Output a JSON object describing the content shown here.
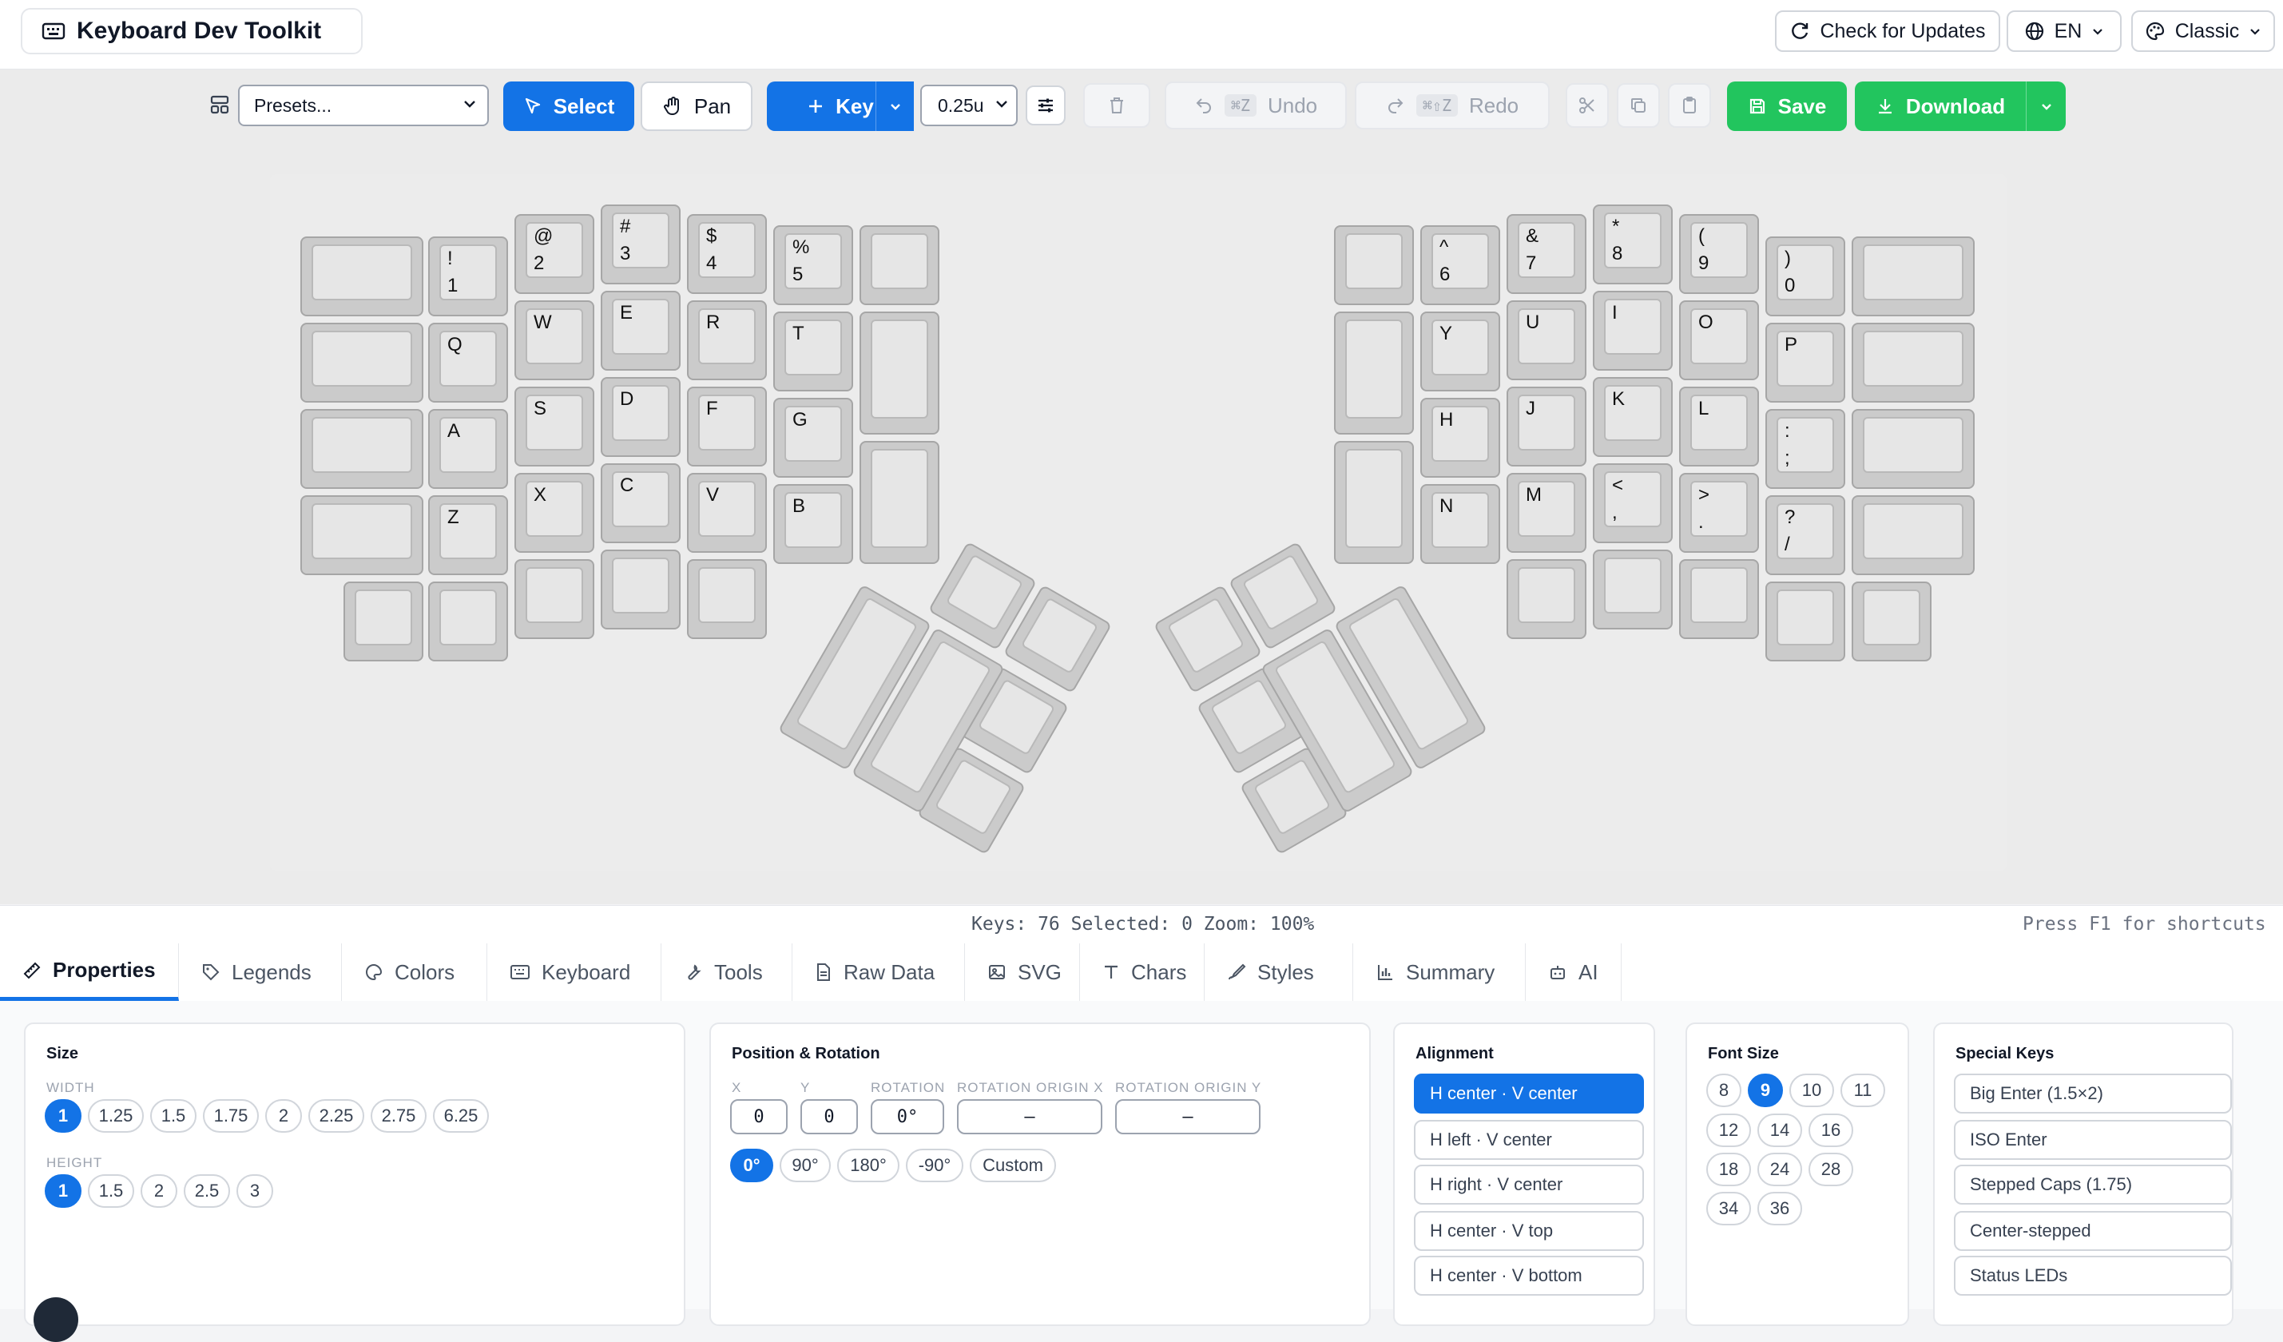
{
  "app": {
    "title": "Keyboard Dev Toolkit"
  },
  "header": {
    "updates_label": "Check for Updates",
    "language_label": "EN",
    "theme_label": "Classic"
  },
  "toolbar": {
    "presets_value": "Presets...",
    "select_label": "Select",
    "pan_label": "Pan",
    "key_label": "Key",
    "step_value": "0.25u",
    "undo_label": "Undo",
    "undo_shortcut": "⌘Z",
    "redo_label": "Redo",
    "redo_shortcut": "⌘⇧Z",
    "save_label": "Save",
    "download_label": "Download"
  },
  "keyboard": {
    "left": [
      {
        "t": "",
        "b": ""
      },
      {
        "t": "!",
        "b": "1"
      },
      {
        "t": "@",
        "b": "2"
      },
      {
        "t": "#",
        "b": "3"
      },
      {
        "t": "$",
        "b": "4"
      },
      {
        "t": "%",
        "b": "5"
      },
      {
        "t": "Q"
      },
      {
        "t": "W"
      },
      {
        "t": "E"
      },
      {
        "t": "R"
      },
      {
        "t": "T"
      },
      {
        "t": "A"
      },
      {
        "t": "S"
      },
      {
        "t": "D"
      },
      {
        "t": "F"
      },
      {
        "t": "G"
      },
      {
        "t": "Z"
      },
      {
        "t": "X"
      },
      {
        "t": "C"
      },
      {
        "t": "V"
      },
      {
        "t": "B"
      }
    ],
    "right": [
      {
        "t": "^",
        "b": "6"
      },
      {
        "t": "&",
        "b": "7"
      },
      {
        "t": "*",
        "b": "8"
      },
      {
        "t": "(",
        "b": "9"
      },
      {
        "t": ")",
        "b": "0"
      },
      {
        "t": "Y"
      },
      {
        "t": "U"
      },
      {
        "t": "I"
      },
      {
        "t": "O"
      },
      {
        "t": "P"
      },
      {
        "t": "H"
      },
      {
        "t": "J"
      },
      {
        "t": "K"
      },
      {
        "t": "L"
      },
      {
        "t": ":",
        "b": ";"
      },
      {
        "t": "N"
      },
      {
        "t": "M"
      },
      {
        "t": "<",
        "b": ","
      },
      {
        "t": ">",
        "b": "."
      },
      {
        "t": "?",
        "b": "/"
      }
    ]
  },
  "status": {
    "info": "Keys: 76 Selected: 0 Zoom: 100%",
    "hint": "Press F1 for shortcuts"
  },
  "tabs": [
    "Properties",
    "Legends",
    "Colors",
    "Keyboard",
    "Tools",
    "Raw Data",
    "SVG",
    "Chars",
    "Styles",
    "Summary",
    "AI"
  ],
  "size_panel": {
    "title": "Size",
    "width_label": "WIDTH",
    "widths": [
      "1",
      "1.25",
      "1.5",
      "1.75",
      "2",
      "2.25",
      "2.75",
      "6.25"
    ],
    "height_label": "HEIGHT",
    "heights": [
      "1",
      "1.5",
      "2",
      "2.5",
      "3"
    ]
  },
  "position_panel": {
    "title": "Position & Rotation",
    "x_label": "X",
    "y_label": "Y",
    "rotation_label": "ROTATION",
    "origin_x_label": "ROTATION ORIGIN X",
    "origin_y_label": "ROTATION ORIGIN Y",
    "x_value": "0",
    "y_value": "0",
    "rotation_value": "0°",
    "origin_x_value": "—",
    "origin_y_value": "—",
    "rotations": [
      "0°",
      "90°",
      "180°",
      "-90°",
      "Custom"
    ]
  },
  "alignment_panel": {
    "title": "Alignment",
    "options": [
      "H center · V center",
      "H left · V center",
      "H right · V center",
      "H center · V top",
      "H center · V bottom"
    ]
  },
  "font_panel": {
    "title": "Font Size",
    "sizes": [
      "8",
      "9",
      "10",
      "11",
      "12",
      "14",
      "16",
      "18",
      "24",
      "28",
      "34",
      "36"
    ]
  },
  "special_panel": {
    "title": "Special Keys",
    "options": [
      "Big Enter (1.5×2)",
      "ISO Enter",
      "Stepped Caps (1.75)",
      "Center-stepped",
      "Status LEDs"
    ]
  },
  "colors": {
    "accent": "#1373e6",
    "success": "#22c55e",
    "key_body": "#cbcbcb",
    "key_cap": "#e6e6e6"
  }
}
